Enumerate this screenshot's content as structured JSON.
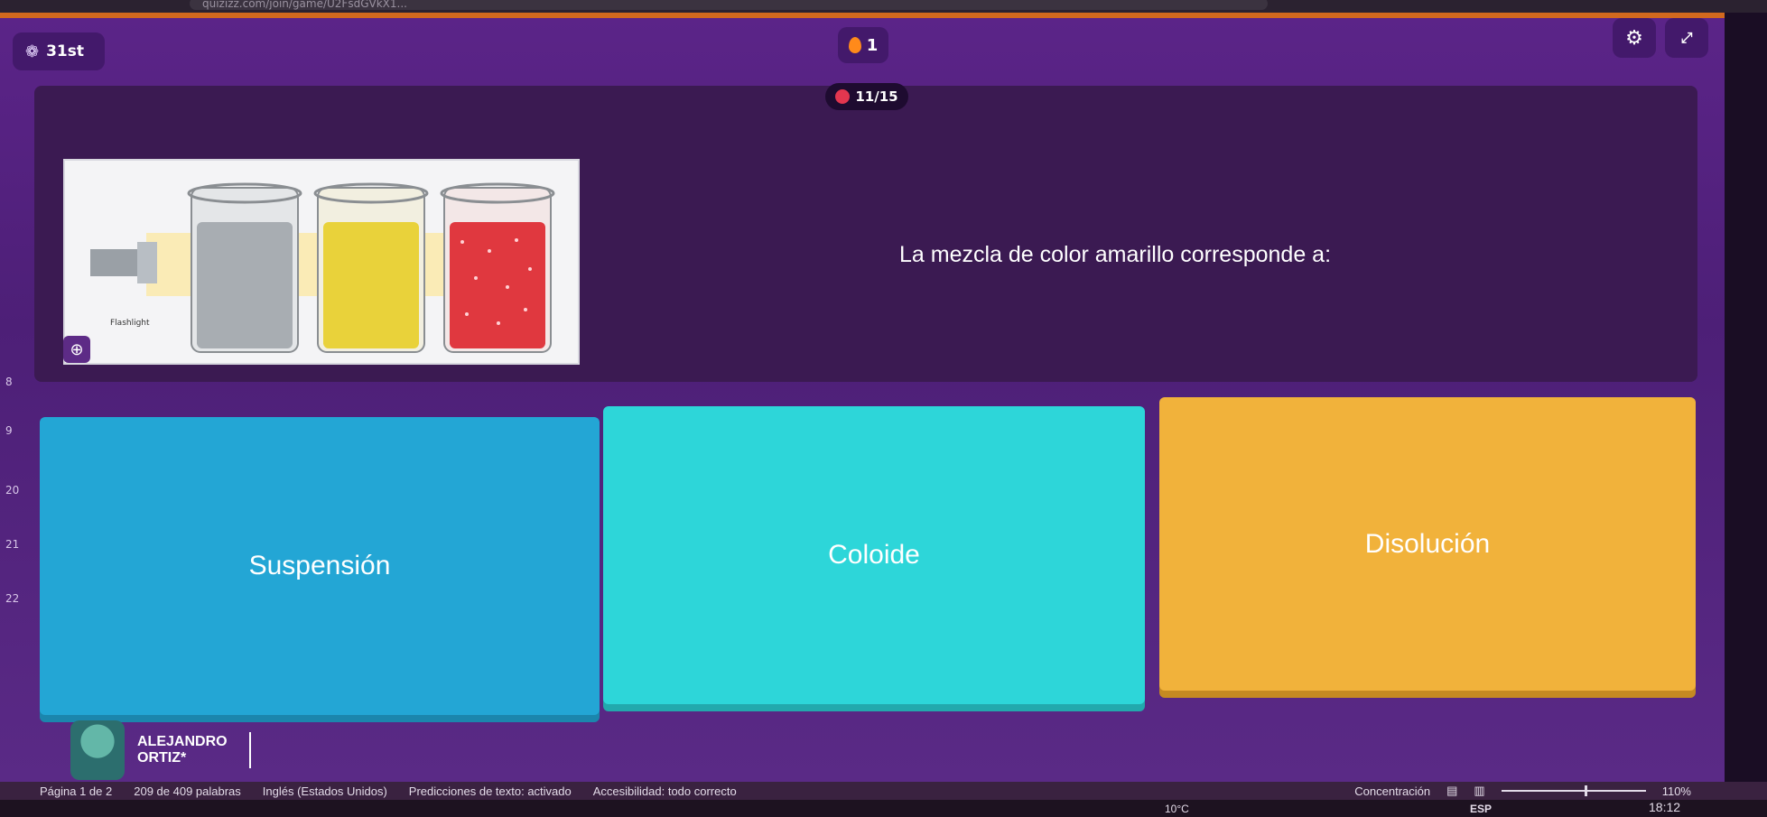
{
  "browser": {
    "url_fragment": "quizizz.com/join/game/U2FsdGVkX1..."
  },
  "top_bar": {
    "rank": "31st",
    "streak": "1",
    "settings_icon": "gear-icon",
    "fullscreen_icon": "expand-icon"
  },
  "progress": {
    "label": "11/15"
  },
  "question": {
    "text": "La mezcla de color amarillo corresponde a:",
    "image_label": "Flashlight"
  },
  "answers": [
    {
      "label": "Suspensión",
      "color": "#23a6d5"
    },
    {
      "label": "Coloide",
      "color": "#2dd6d9"
    },
    {
      "label": "Disolución",
      "color": "#f1b23b"
    }
  ],
  "player": {
    "name": "ALEJANDRO ORTIZ*"
  },
  "ruler_marks": [
    "8",
    "9",
    "20",
    "21",
    "22"
  ],
  "status_bar": {
    "page": "Página 1 de 2",
    "words": "209 de 409 palabras",
    "language": "Inglés (Estados Unidos)",
    "predictions": "Predicciones de texto: activado",
    "accessibility": "Accesibilidad: todo correcto",
    "focus": "Concentración",
    "zoom": "110%"
  },
  "taskbar": {
    "weather": "10°C",
    "lang": "ESP",
    "time": "18:12"
  }
}
